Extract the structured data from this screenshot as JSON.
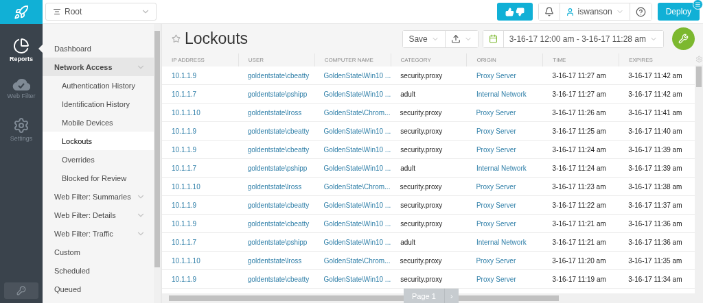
{
  "rail": {
    "items": [
      {
        "kind": "reports",
        "label": "Reports",
        "selected": true
      },
      {
        "kind": "webfilter",
        "label": "Web Filter",
        "selected": false
      },
      {
        "kind": "settings",
        "label": "Settings",
        "selected": false
      }
    ]
  },
  "scope": {
    "value": "Root"
  },
  "header": {
    "user": "iswanson",
    "deploy": "Deploy"
  },
  "sidebar": {
    "items": [
      {
        "label": "Dashboard",
        "selected": false
      },
      {
        "label": "Network Access",
        "selected": false,
        "expanded": true,
        "children": [
          {
            "label": "Authentication History",
            "selected": false
          },
          {
            "label": "Identification History",
            "selected": false
          },
          {
            "label": "Mobile Devices",
            "selected": false
          },
          {
            "label": "Lockouts",
            "selected": true
          },
          {
            "label": "Overrides",
            "selected": false
          },
          {
            "label": "Blocked for Review",
            "selected": false
          }
        ]
      },
      {
        "label": "Web Filter: Summaries",
        "selected": false,
        "expanded": false
      },
      {
        "label": "Web Filter: Details",
        "selected": false,
        "expanded": false
      },
      {
        "label": "Web Filter: Traffic",
        "selected": false,
        "expanded": false
      },
      {
        "label": "Custom",
        "selected": false
      },
      {
        "label": "Scheduled",
        "selected": false
      },
      {
        "label": "Queued",
        "selected": false
      }
    ]
  },
  "report": {
    "title": "Lockouts",
    "favorite": false,
    "save": "Save",
    "date_range": "3-16-17 12:00 am - 3-16-17 11:28 am"
  },
  "table": {
    "columns": [
      "IP ADDRESS",
      "USER",
      "COMPUTER NAME",
      "CATEGORY",
      "ORIGIN",
      "TIME",
      "EXPIRES"
    ],
    "rows": [
      [
        "10.1.1.9",
        "goldentstate\\cbeatty",
        "GoldenState\\Win10 ...",
        "security.proxy",
        "Proxy Server",
        "3-16-17 11:27 am",
        "3-16-17 11:42 am"
      ],
      [
        "10.1.1.7",
        "goldentstate\\pshipp",
        "GoldenState\\Win10 ...",
        "adult",
        "Internal Network",
        "3-16-17 11:27 am",
        "3-16-17 11:42 am"
      ],
      [
        "10.1.1.10",
        "goldentstate\\lross",
        "GoldenState\\Chrom...",
        "security.proxy",
        "Proxy Server",
        "3-16-17 11:26 am",
        "3-16-17 11:41 am"
      ],
      [
        "10.1.1.9",
        "goldentstate\\cbeatty",
        "GoldenState\\Win10 ...",
        "security.proxy",
        "Proxy Server",
        "3-16-17 11:25 am",
        "3-16-17 11:40 am"
      ],
      [
        "10.1.1.9",
        "goldentstate\\cbeatty",
        "GoldenState\\Win10 ...",
        "security.proxy",
        "Proxy Server",
        "3-16-17 11:24 am",
        "3-16-17 11:39 am"
      ],
      [
        "10.1.1.7",
        "goldentstate\\pshipp",
        "GoldenState\\Win10 ...",
        "adult",
        "Internal Network",
        "3-16-17 11:24 am",
        "3-16-17 11:39 am"
      ],
      [
        "10.1.1.10",
        "goldentstate\\lross",
        "GoldenState\\Chrom...",
        "security.proxy",
        "Proxy Server",
        "3-16-17 11:23 am",
        "3-16-17 11:38 am"
      ],
      [
        "10.1.1.9",
        "goldentstate\\cbeatty",
        "GoldenState\\Win10 ...",
        "security.proxy",
        "Proxy Server",
        "3-16-17 11:22 am",
        "3-16-17 11:37 am"
      ],
      [
        "10.1.1.9",
        "goldentstate\\cbeatty",
        "GoldenState\\Win10 ...",
        "security.proxy",
        "Proxy Server",
        "3-16-17 11:21 am",
        "3-16-17 11:36 am"
      ],
      [
        "10.1.1.7",
        "goldentstate\\pshipp",
        "GoldenState\\Win10 ...",
        "adult",
        "Internal Network",
        "3-16-17 11:21 am",
        "3-16-17 11:36 am"
      ],
      [
        "10.1.1.10",
        "goldentstate\\lross",
        "GoldenState\\Chrom...",
        "security.proxy",
        "Proxy Server",
        "3-16-17 11:20 am",
        "3-16-17 11:35 am"
      ],
      [
        "10.1.1.9",
        "goldentstate\\cbeatty",
        "GoldenState\\Win10 ...",
        "security.proxy",
        "Proxy Server",
        "3-16-17 11:19 am",
        "3-16-17 11:34 am"
      ]
    ]
  },
  "pager": {
    "label": "Page 1",
    "next": "›"
  }
}
